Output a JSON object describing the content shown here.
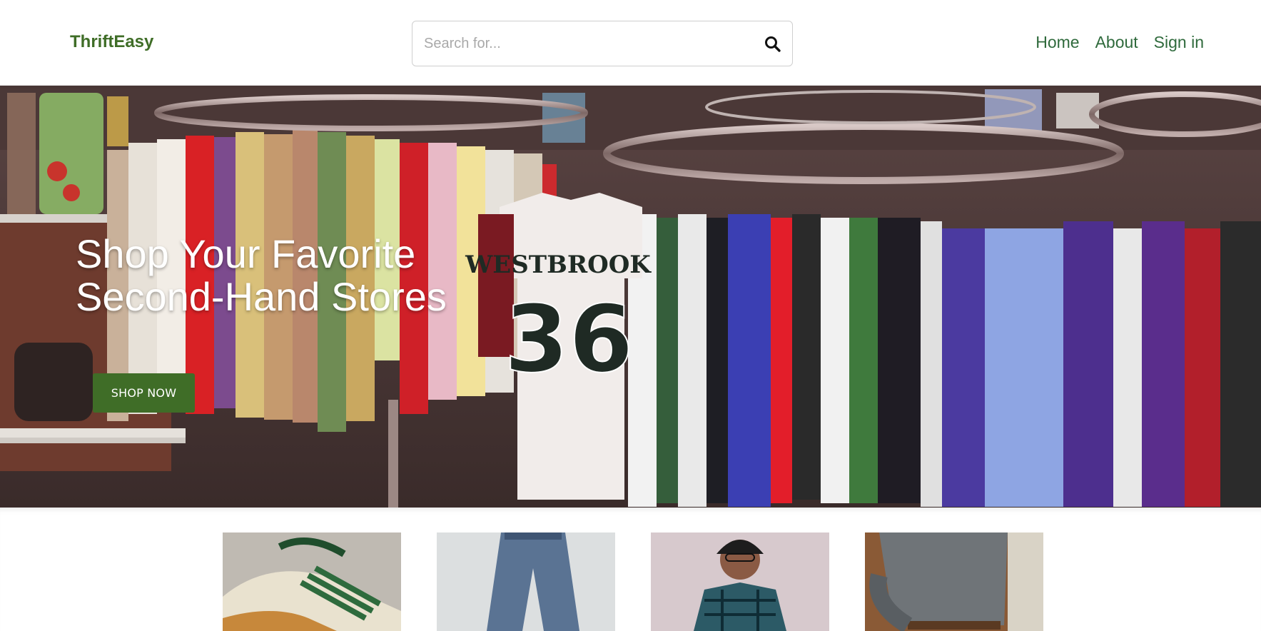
{
  "header": {
    "logo": "ThriftEasy",
    "search": {
      "placeholder": "Search for...",
      "icon": "search-icon"
    },
    "nav": [
      {
        "label": "Home"
      },
      {
        "label": "About"
      },
      {
        "label": "Sign in"
      }
    ]
  },
  "hero": {
    "title_line1": "Shop Your Favorite",
    "title_line2": "Second-Hand Stores",
    "cta_label": "SHOP NOW",
    "jersey_name": "WESTBROOK",
    "jersey_number": "36"
  },
  "colors": {
    "brand_green": "#3f6d27",
    "nav_green": "#2f6a3c",
    "button_text": "#ffffff"
  },
  "products": [
    {
      "name": "product-sneakers"
    },
    {
      "name": "product-jeans"
    },
    {
      "name": "product-flannel"
    },
    {
      "name": "product-sweater"
    }
  ]
}
